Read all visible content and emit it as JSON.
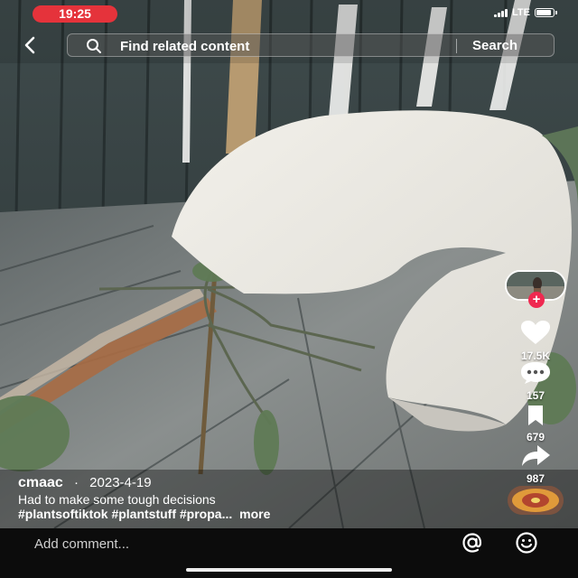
{
  "status_bar": {
    "time": "19:25",
    "network": "LTE"
  },
  "search": {
    "placeholder": "Find related content",
    "button_label": "Search"
  },
  "actions": {
    "likes": "17.5K",
    "comments": "157",
    "saves": "679",
    "shares": "987"
  },
  "post": {
    "username": "cmaac",
    "separator": "·",
    "date": "2023-4-19",
    "caption": "Had to make some tough decisions",
    "hashtags": "#plantsoftiktok #plantstuff #propa...",
    "more_label": "more"
  },
  "comment_bar": {
    "placeholder": "Add comment..."
  },
  "colors": {
    "accent": "#ef2950",
    "status_pill": "#e5333b"
  },
  "icons": [
    "back-arrow-icon",
    "search-icon",
    "heart-icon",
    "comment-icon",
    "bookmark-icon",
    "share-icon",
    "at-icon",
    "emoji-icon"
  ]
}
